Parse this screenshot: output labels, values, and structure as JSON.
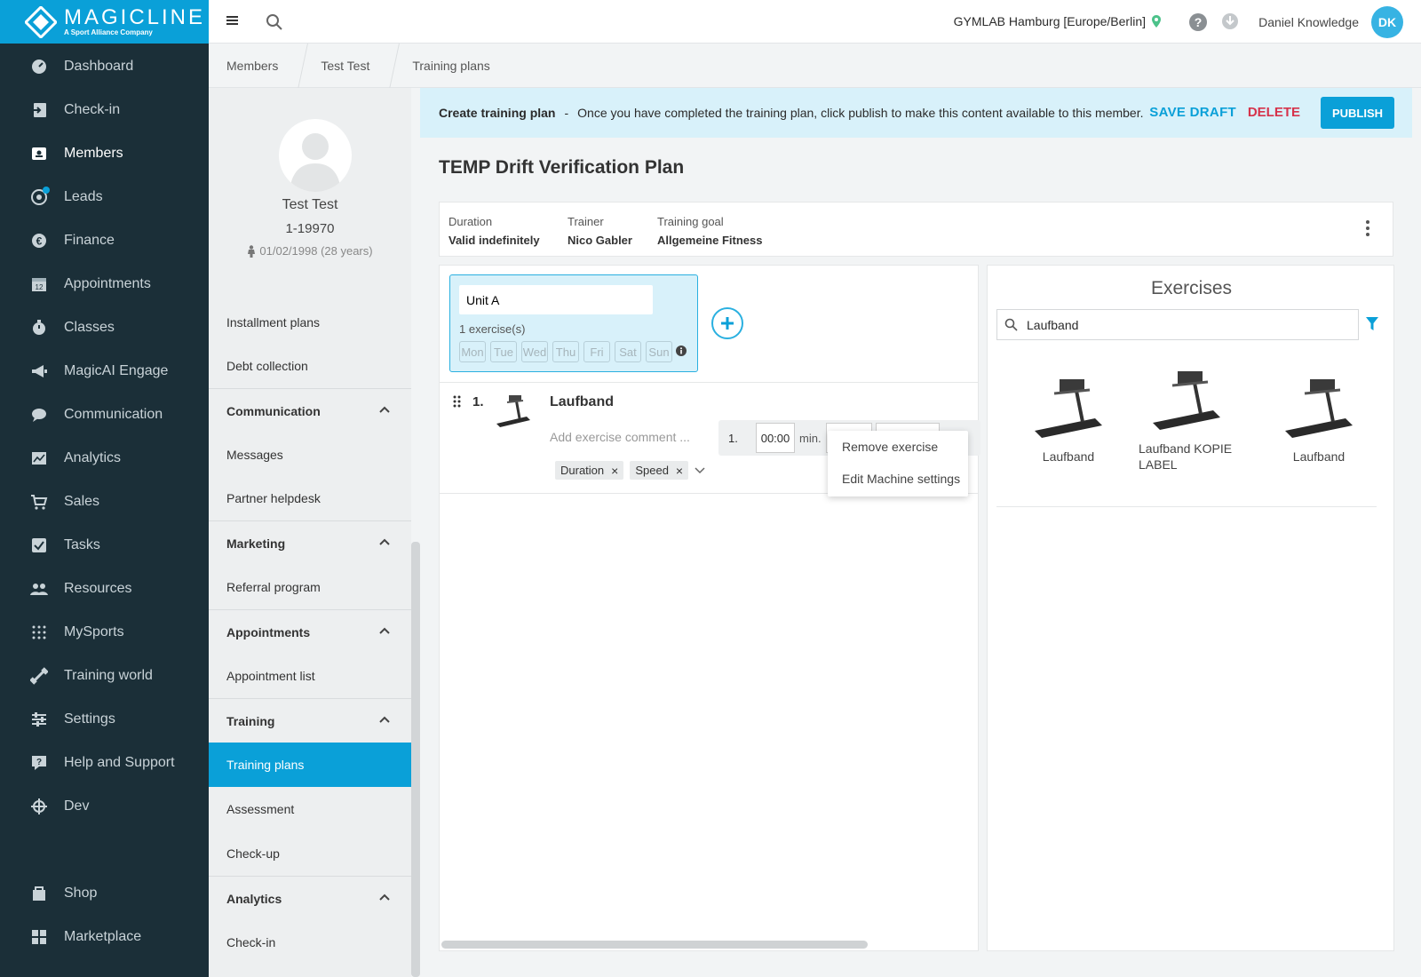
{
  "brand": {
    "name": "MAGICLINE",
    "tagline": "A Sport Alliance Company"
  },
  "nav": {
    "items": [
      {
        "label": "Dashboard",
        "icon": "gauge-icon"
      },
      {
        "label": "Check-in",
        "icon": "check-in-icon"
      },
      {
        "label": "Members",
        "icon": "member-card-icon"
      },
      {
        "label": "Leads",
        "icon": "leads-icon"
      },
      {
        "label": "Finance",
        "icon": "euro-icon"
      },
      {
        "label": "Appointments",
        "icon": "calendar-icon"
      },
      {
        "label": "Classes",
        "icon": "stopwatch-icon"
      },
      {
        "label": "MagicAI Engage",
        "icon": "megaphone-icon"
      },
      {
        "label": "Communication",
        "icon": "chat-icon"
      },
      {
        "label": "Analytics",
        "icon": "chart-icon"
      },
      {
        "label": "Sales",
        "icon": "cart-icon"
      },
      {
        "label": "Tasks",
        "icon": "checkbox-icon"
      },
      {
        "label": "Resources",
        "icon": "people-icon"
      },
      {
        "label": "MySports",
        "icon": "dots-grid-icon"
      },
      {
        "label": "Training world",
        "icon": "dumbbell-icon"
      },
      {
        "label": "Settings",
        "icon": "sliders-icon"
      },
      {
        "label": "Help and Support",
        "icon": "help-icon"
      },
      {
        "label": "Dev",
        "icon": "crosshair-icon"
      },
      {
        "label": "Shop",
        "icon": "shop-icon"
      },
      {
        "label": "Marketplace",
        "icon": "grid-icon"
      }
    ],
    "active": "Members"
  },
  "topbar": {
    "location": "GYMLAB Hamburg [Europe/Berlin]",
    "user": "Daniel Knowledge",
    "initials": "DK"
  },
  "breadcrumb": [
    "Members",
    "Test Test",
    "Training plans"
  ],
  "member": {
    "name": "Test Test",
    "id": "1-19970",
    "birth": "01/02/1998 (28 years)"
  },
  "member_menu": {
    "installment": "Installment plans",
    "debt": "Debt collection",
    "comm_header": "Communication",
    "messages": "Messages",
    "helpdesk": "Partner helpdesk",
    "mkt_header": "Marketing",
    "referral": "Referral program",
    "appt_header": "Appointments",
    "appt_list": "Appointment list",
    "train_header": "Training",
    "plans": "Training plans",
    "assessment": "Assessment",
    "checkup": "Check-up",
    "ana_header": "Analytics",
    "checkin": "Check-in"
  },
  "notice": {
    "title": "Create training plan",
    "sep": "-",
    "text": "Once you have completed the training plan, click publish to make this content available to this member.",
    "save": "SAVE DRAFT",
    "delete": "DELETE",
    "publish": "PUBLISH"
  },
  "plan": {
    "title": "TEMP Drift Verification Plan",
    "duration_label": "Duration",
    "duration": "Valid indefinitely",
    "trainer_label": "Trainer",
    "trainer": "Nico Gabler",
    "goal_label": "Training goal",
    "goal": "Allgemeine Fitness"
  },
  "unit": {
    "name": "Unit A",
    "count": "1 exercise(s)",
    "days": [
      "Mon",
      "Tue",
      "Wed",
      "Thu",
      "Fri",
      "Sat",
      "Sun"
    ]
  },
  "exercise": {
    "num": "1.",
    "name": "Laufband",
    "comment": "Add exercise comment ...",
    "tags": [
      "Duration",
      "Speed"
    ],
    "set_num": "1.",
    "set_value": "00:00",
    "set_unit": "min."
  },
  "context_menu": [
    "Remove exercise",
    "Edit Machine settings"
  ],
  "exercises": {
    "title": "Exercises",
    "search": "Laufband",
    "cards": [
      "Laufband",
      "Laufband KOPIE LABEL",
      "Laufband"
    ]
  },
  "colors": {
    "accent": "#0aa0d8",
    "danger": "#d6334b",
    "nav_bg": "#1b2f38",
    "location_pin": "#4cc28a"
  }
}
